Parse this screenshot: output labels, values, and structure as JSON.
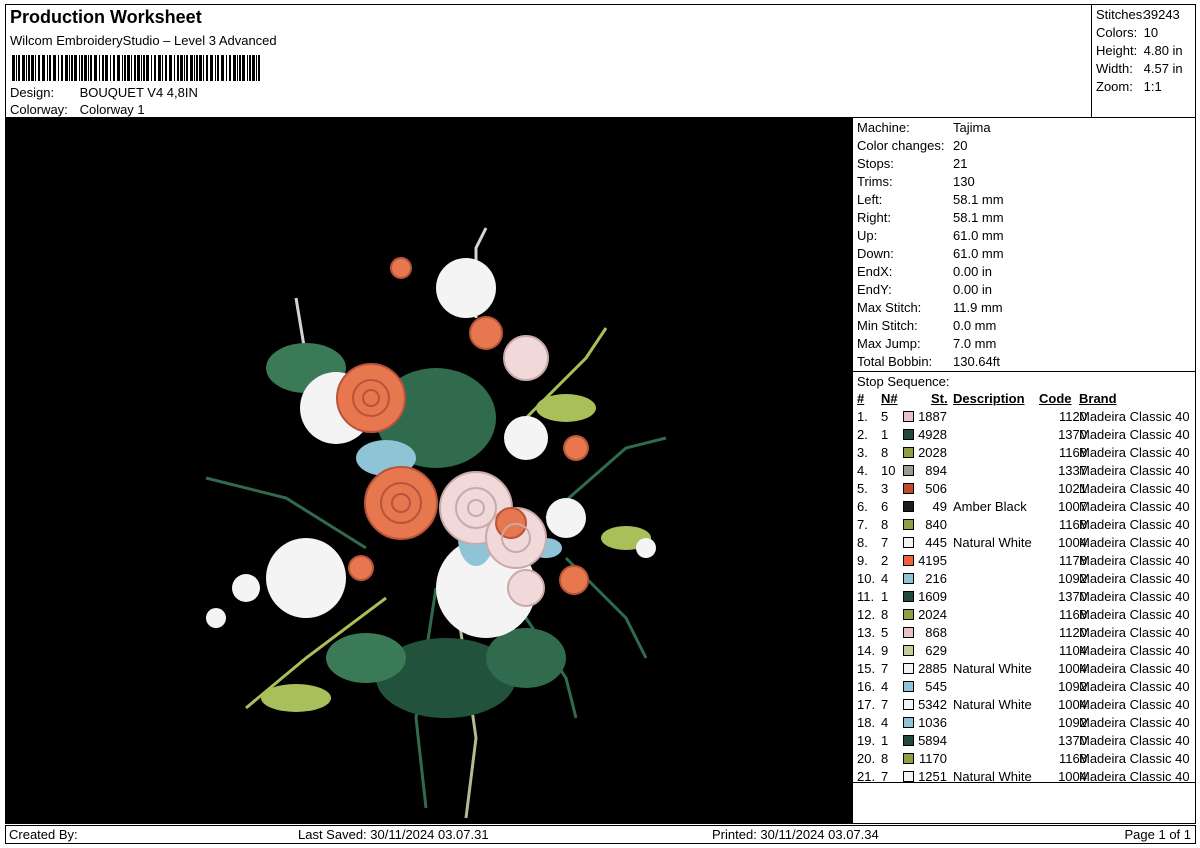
{
  "header": {
    "title": "Production Worksheet",
    "subtitle": "Wilcom EmbroideryStudio – Level 3 Advanced",
    "barcode_icon": "barcode-icon",
    "design_label": "Design:",
    "design_value": "BOUQUET V4 4,8IN",
    "colorway_label": "Colorway:",
    "colorway_value": "Colorway 1"
  },
  "stats": {
    "stitches_label": "Stitches:",
    "stitches": "39243",
    "colors_label": "Colors:",
    "colors": "10",
    "height_label": "Height:",
    "height": "4.80 in",
    "width_label": "Width:",
    "width": "4.57 in",
    "zoom_label": "Zoom:",
    "zoom": "1:1"
  },
  "machine_info": [
    {
      "label": "Machine:",
      "value": "Tajima"
    },
    {
      "label": "Color changes:",
      "value": "20"
    },
    {
      "label": "Stops:",
      "value": "21"
    },
    {
      "label": "Trims:",
      "value": "130"
    },
    {
      "label": "Left:",
      "value": "58.1 mm"
    },
    {
      "label": "Right:",
      "value": "58.1 mm"
    },
    {
      "label": "Up:",
      "value": "61.0 mm"
    },
    {
      "label": "Down:",
      "value": "61.0 mm"
    },
    {
      "label": "EndX:",
      "value": "0.00 in"
    },
    {
      "label": "EndY:",
      "value": "0.00 in"
    },
    {
      "label": "Max Stitch:",
      "value": "11.9 mm"
    },
    {
      "label": "Min Stitch:",
      "value": "0.0 mm"
    },
    {
      "label": "Max Jump:",
      "value": "7.0 mm"
    },
    {
      "label": "Total Bobbin:",
      "value": "130.64ft"
    }
  ],
  "stop_sequence": {
    "title": "Stop Sequence:",
    "headers": {
      "idx": "#",
      "n": "N#",
      "st": "St.",
      "desc": "Description",
      "code": "Code",
      "brand": "Brand"
    },
    "rows": [
      {
        "idx": "1.",
        "n": "5",
        "color": "#e8c2c6",
        "st": "1887",
        "desc": "",
        "code": "1120",
        "brand": "Madeira Classic 40"
      },
      {
        "idx": "2.",
        "n": "1",
        "color": "#1f4a35",
        "st": "4928",
        "desc": "",
        "code": "1370",
        "brand": "Madeira Classic 40"
      },
      {
        "idx": "3.",
        "n": "8",
        "color": "#8fa043",
        "st": "2028",
        "desc": "",
        "code": "1168",
        "brand": "Madeira Classic 40"
      },
      {
        "idx": "4.",
        "n": "10",
        "color": "#9b9b8f",
        "st": "894",
        "desc": "",
        "code": "1337",
        "brand": "Madeira Classic 40"
      },
      {
        "idx": "5.",
        "n": "3",
        "color": "#c04a2e",
        "st": "506",
        "desc": "",
        "code": "1021",
        "brand": "Madeira Classic 40"
      },
      {
        "idx": "6.",
        "n": "6",
        "color": "#1c1c1c",
        "st": "49",
        "desc": "Amber Black",
        "code": "1007",
        "brand": "Madeira Classic 40"
      },
      {
        "idx": "7.",
        "n": "8",
        "color": "#8fa043",
        "st": "840",
        "desc": "",
        "code": "1168",
        "brand": "Madeira Classic 40"
      },
      {
        "idx": "8.",
        "n": "7",
        "color": "#f4f4f4",
        "st": "445",
        "desc": "Natural White",
        "code": "1004",
        "brand": "Madeira Classic 40"
      },
      {
        "idx": "9.",
        "n": "2",
        "color": "#f2603a",
        "st": "4195",
        "desc": "",
        "code": "1178",
        "brand": "Madeira Classic 40"
      },
      {
        "idx": "10.",
        "n": "4",
        "color": "#8fc3d6",
        "st": "216",
        "desc": "",
        "code": "1092",
        "brand": "Madeira Classic 40"
      },
      {
        "idx": "11.",
        "n": "1",
        "color": "#1f4a35",
        "st": "1609",
        "desc": "",
        "code": "1370",
        "brand": "Madeira Classic 40"
      },
      {
        "idx": "12.",
        "n": "8",
        "color": "#8fa043",
        "st": "2024",
        "desc": "",
        "code": "1168",
        "brand": "Madeira Classic 40"
      },
      {
        "idx": "13.",
        "n": "5",
        "color": "#e8c2c6",
        "st": "868",
        "desc": "",
        "code": "1120",
        "brand": "Madeira Classic 40"
      },
      {
        "idx": "14.",
        "n": "9",
        "color": "#c3cf95",
        "st": "629",
        "desc": "",
        "code": "1104",
        "brand": "Madeira Classic 40"
      },
      {
        "idx": "15.",
        "n": "7",
        "color": "#f4f4f4",
        "st": "2885",
        "desc": "Natural White",
        "code": "1004",
        "brand": "Madeira Classic 40"
      },
      {
        "idx": "16.",
        "n": "4",
        "color": "#8fc3d6",
        "st": "545",
        "desc": "",
        "code": "1092",
        "brand": "Madeira Classic 40"
      },
      {
        "idx": "17.",
        "n": "7",
        "color": "#f4f4f4",
        "st": "5342",
        "desc": "Natural White",
        "code": "1004",
        "brand": "Madeira Classic 40"
      },
      {
        "idx": "18.",
        "n": "4",
        "color": "#8fc3d6",
        "st": "1036",
        "desc": "",
        "code": "1092",
        "brand": "Madeira Classic 40"
      },
      {
        "idx": "19.",
        "n": "1",
        "color": "#1f4a35",
        "st": "5894",
        "desc": "",
        "code": "1370",
        "brand": "Madeira Classic 40"
      },
      {
        "idx": "20.",
        "n": "8",
        "color": "#8fa043",
        "st": "1170",
        "desc": "",
        "code": "1168",
        "brand": "Madeira Classic 40"
      },
      {
        "idx": "21.",
        "n": "7",
        "color": "#f4f4f4",
        "st": "1251",
        "desc": "Natural White",
        "code": "1004",
        "brand": "Madeira Classic 40"
      }
    ]
  },
  "design_preview": {
    "icon": "embroidery-bouquet-image",
    "background": "#000000",
    "rose_colors": [
      "#e6774f",
      "#f0d9d8",
      "#f4f4f4",
      "#8fc3d6",
      "#2f6b4c",
      "#a9bf5a"
    ]
  },
  "footer": {
    "created_by": "Created By:",
    "last_saved": "Last Saved: 30/11/2024 03.07.31",
    "printed": "Printed: 30/11/2024 03.07.34",
    "page": "Page 1 of 1"
  }
}
